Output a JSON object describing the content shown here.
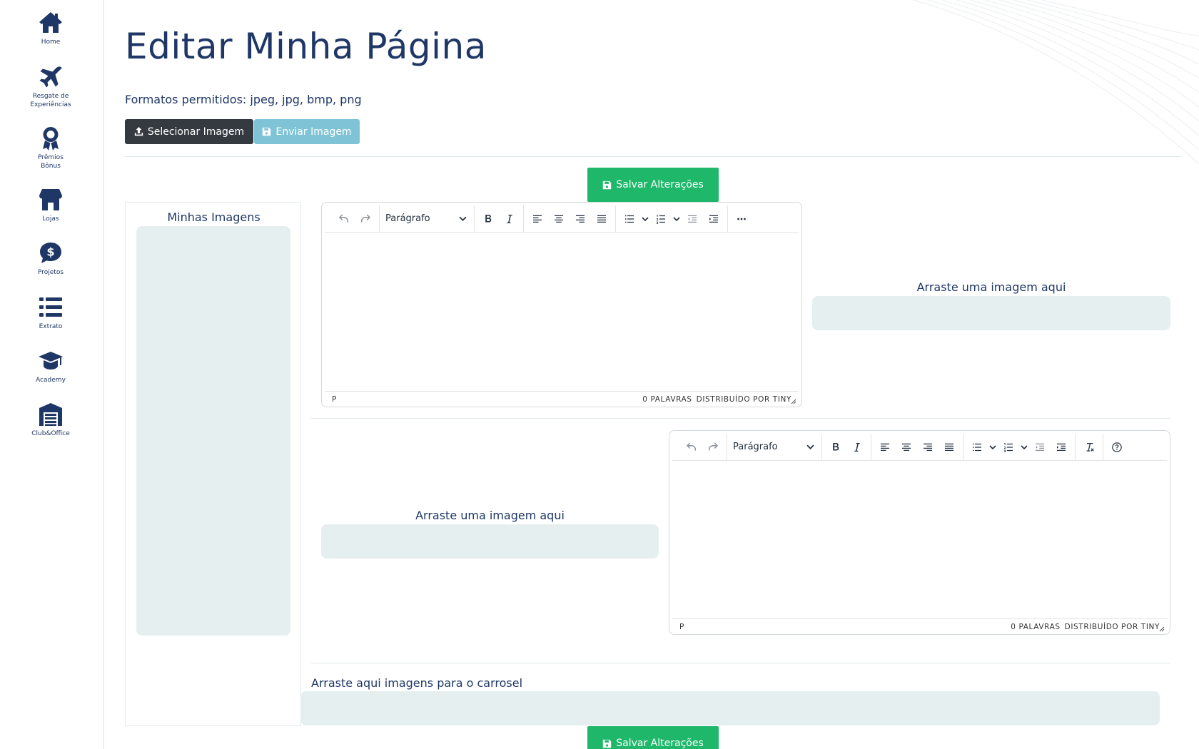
{
  "sidebar": {
    "items": [
      {
        "label": "Home",
        "icon": "home-icon"
      },
      {
        "label": "Resgate de\nExperiências",
        "icon": "airplane-icon"
      },
      {
        "label": "Prêmios\nBônus",
        "icon": "award-icon"
      },
      {
        "label": "Lojas",
        "icon": "store-icon"
      },
      {
        "label": "Projetos",
        "icon": "dollar-bubble-icon"
      },
      {
        "label": "Extrato",
        "icon": "list-icon"
      },
      {
        "label": "Academy",
        "icon": "graduation-cap-icon"
      },
      {
        "label": "Club&Office",
        "icon": "warehouse-icon"
      }
    ]
  },
  "page": {
    "title": "Editar Minha Página",
    "formats_text": "Formatos permitidos: jpeg, jpg, bmp, png"
  },
  "buttons": {
    "select_image": "Selecionar Imagem",
    "send_image": "Enviar Imagem",
    "save_changes": "Salvar Alterações"
  },
  "images_panel": {
    "title": "Minhas Imagens"
  },
  "editor": {
    "block_format": "Parágrafo",
    "path": "P",
    "word_count": "0 PALAVRAS",
    "branding": "DISTRIBUÍDO POR TINY"
  },
  "dropzones": {
    "image_label": "Arraste uma imagem aqui",
    "carousel_label": "Arraste aqui imagens para o carrosel"
  },
  "colors": {
    "primary": "#1e3766",
    "save_green": "#1fb86a",
    "dark_button": "#343a40",
    "light_button": "#7fc4d6",
    "dropzone_bg": "#e6efef"
  }
}
